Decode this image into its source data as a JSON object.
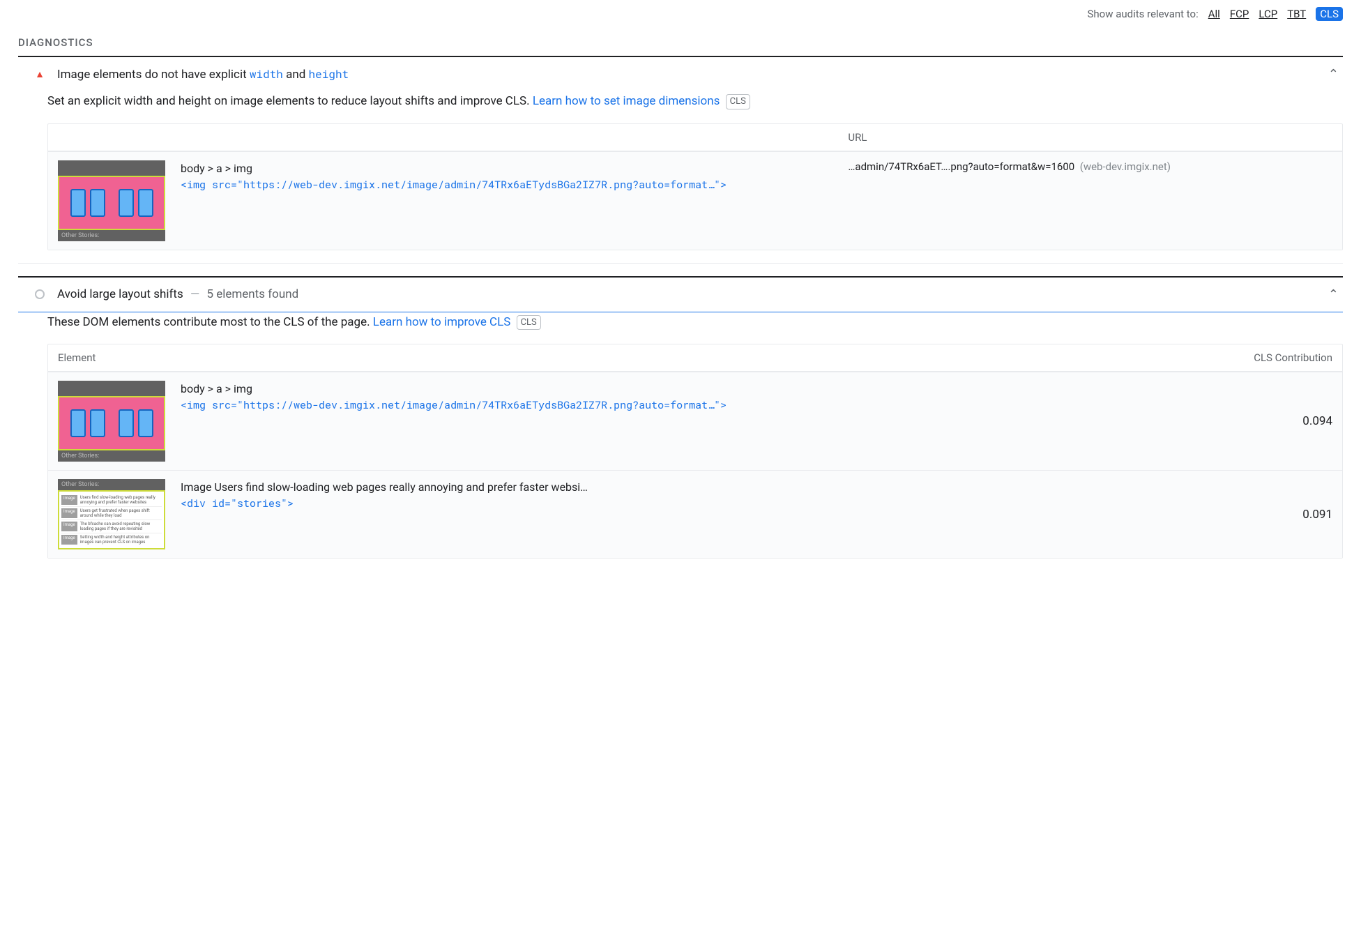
{
  "filter": {
    "label": "Show audits relevant to:",
    "items": [
      "All",
      "FCP",
      "LCP",
      "TBT",
      "CLS"
    ],
    "active": "CLS"
  },
  "section_title": "DIAGNOSTICS",
  "audits": [
    {
      "icon": "triangle-red",
      "title_pre": "Image elements do not have explicit ",
      "code1": "width",
      "mid": " and ",
      "code2": "height",
      "desc_pre": "Set an explicit width and height on image elements to reduce layout shifts and improve CLS. ",
      "desc_link": "Learn how to set image dimensions",
      "badge": "CLS",
      "table": {
        "header_url": "URL",
        "row": {
          "selector": "body > a > img",
          "snippet": "<img src=\"https://web-dev.imgix.net/image/admin/74TRx6aETydsBGa2IZ7R.png?auto=format…\">",
          "url_text": "…admin/74TRx6aET….png?auto=format&w=1600",
          "url_host": "(web-dev.imgix.net)",
          "thumb_label": "Other Stories:"
        }
      }
    },
    {
      "icon": "circle-gray",
      "title": "Avoid large layout shifts",
      "subtitle": "5 elements found",
      "desc_pre": "These DOM elements contribute most to the CLS of the page. ",
      "desc_link": "Learn how to improve CLS",
      "badge": "CLS",
      "table": {
        "header_element": "Element",
        "header_cls": "CLS Contribution",
        "rows": [
          {
            "selector": "body > a > img",
            "snippet": "<img src=\"https://web-dev.imgix.net/image/admin/74TRx6aETydsBGa2IZ7R.png?auto=format…\">",
            "value": "0.094",
            "thumb_label": "Other Stories:"
          },
          {
            "text": "Image Users find slow-loading web pages really annoying and prefer faster websi…",
            "snippet": "<div id=\"stories\">",
            "value": "0.091",
            "thumb_label": "Other Stories:",
            "stories": [
              "Users find slow-loading web pages really annoying and prefer faster websites",
              "Users get frustrated when pages shift around while they load",
              "The bfcache can avoid repeating slow loading pages if they are revisited",
              "Setting width and height attributes on images can prevent CLS on images"
            ]
          }
        ]
      }
    }
  ]
}
